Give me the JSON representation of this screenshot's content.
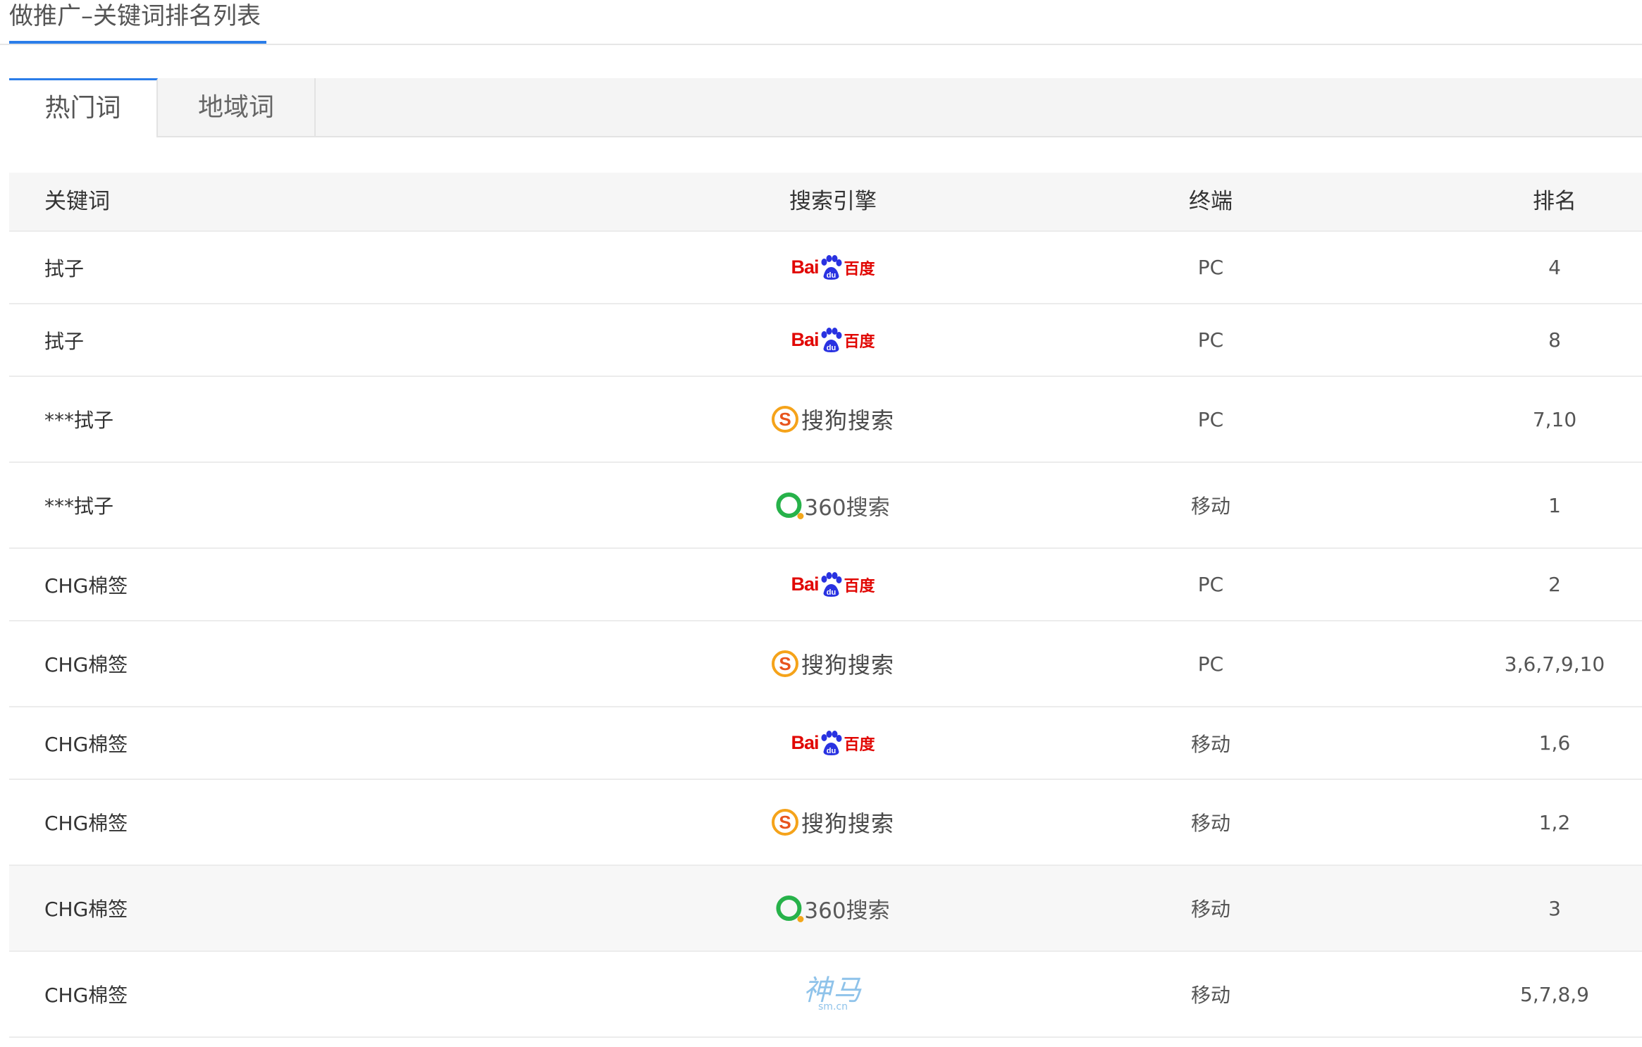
{
  "page_title": "做推广–关键词排名列表",
  "tabs": [
    {
      "label": "热门词",
      "active": true
    },
    {
      "label": "地域词",
      "active": false
    }
  ],
  "table": {
    "headers": {
      "keyword": "关键词",
      "engine": "搜索引擎",
      "terminal": "终端",
      "rank": "排名"
    },
    "rows": [
      {
        "keyword": "拭子",
        "engine": "baidu",
        "terminal": "PC",
        "rank": "4"
      },
      {
        "keyword": "拭子",
        "engine": "baidu",
        "terminal": "PC",
        "rank": "8"
      },
      {
        "keyword": "***拭子",
        "engine": "sogou",
        "terminal": "PC",
        "rank": "7,10"
      },
      {
        "keyword": "***拭子",
        "engine": "360",
        "terminal": "移动",
        "rank": "1"
      },
      {
        "keyword": "CHG棉签",
        "engine": "baidu",
        "terminal": "PC",
        "rank": "2"
      },
      {
        "keyword": "CHG棉签",
        "engine": "sogou",
        "terminal": "PC",
        "rank": "3,6,7,9,10"
      },
      {
        "keyword": "CHG棉签",
        "engine": "baidu",
        "terminal": "移动",
        "rank": "1,6"
      },
      {
        "keyword": "CHG棉签",
        "engine": "sogou",
        "terminal": "移动",
        "rank": "1,2"
      },
      {
        "keyword": "CHG棉签",
        "engine": "360",
        "terminal": "移动",
        "rank": "3"
      },
      {
        "keyword": "CHG棉签",
        "engine": "shenma",
        "terminal": "移动",
        "rank": "5,7,8,9"
      }
    ]
  },
  "engine_logos": {
    "baidu": {
      "latin": "Bai",
      "paw_text": "du",
      "cn": "百度",
      "color": "#e10602",
      "accent": "#2932e1"
    },
    "sogou": {
      "mark": "S",
      "text": "搜狗搜索",
      "color": "#f5a31a"
    },
    "360": {
      "text": "360搜索",
      "color": "#27b24a",
      "accent": "#f3a71b"
    },
    "shenma": {
      "text": "神马",
      "sub": "sm.cn",
      "color": "#8fc3ea"
    }
  },
  "colors": {
    "accent": "#2b7de9",
    "header_bg": "#f6f6f6",
    "tab_bg": "#f4f4f4",
    "border": "#ececec"
  }
}
